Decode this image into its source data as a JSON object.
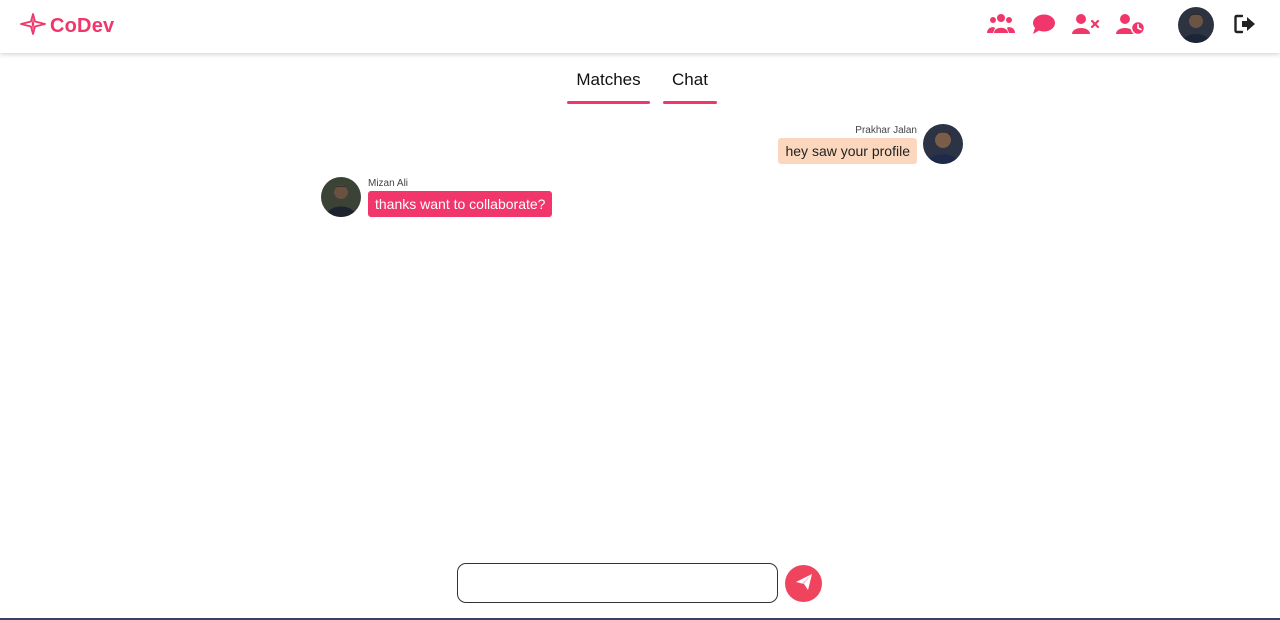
{
  "brand": {
    "name": "CoDev",
    "logo_icon": "compass-sparkle-icon",
    "color": "#f0366a"
  },
  "nav": {
    "icons": [
      "users-group-icon",
      "chat-bubble-icon",
      "user-remove-icon",
      "user-clock-icon",
      "avatar",
      "logout-icon"
    ],
    "accent_color": "#f0366a"
  },
  "tabs": [
    {
      "label": "Matches"
    },
    {
      "label": "Chat"
    }
  ],
  "messages": [
    {
      "sender": "Prakhar Jalan",
      "text": "hey saw your profile",
      "side": "right",
      "bubble_color": "#fbd8bd"
    },
    {
      "sender": "Mizan Ali",
      "text": "thanks want to collaborate?",
      "side": "left",
      "bubble_color": "#f0366a"
    }
  ],
  "composer": {
    "value": "",
    "placeholder": "",
    "send_icon": "paper-plane-icon",
    "send_color": "#f0445e"
  }
}
